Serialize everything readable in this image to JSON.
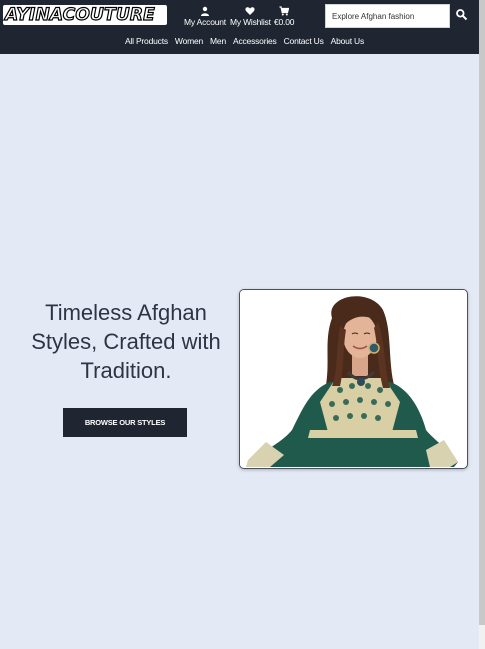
{
  "header": {
    "logo_text": "AYINACOUTURE",
    "account_label": "My Account",
    "wishlist_label": "My Wishlist",
    "cart_total": "€0.00",
    "search": {
      "placeholder": "Explore Afghan fashion",
      "value": ""
    }
  },
  "nav": {
    "items": [
      "All Products",
      "Women",
      "Men",
      "Accessories",
      "Contact Us",
      "About Us"
    ]
  },
  "hero": {
    "title_line1": "Timeless Afghan",
    "title_line2": "Styles, Crafted with",
    "title_line3": "Tradition.",
    "cta_label": "BROWSE OUR STYLES"
  },
  "icons": {
    "account": "user-icon",
    "wishlist": "heart-icon",
    "cart": "cart-icon",
    "search": "search-icon"
  },
  "colors": {
    "header_bg": "#1f2631",
    "page_bg": "#e3e9f5",
    "title_text": "#2e3542",
    "dress_green": "#1f5a4c"
  }
}
